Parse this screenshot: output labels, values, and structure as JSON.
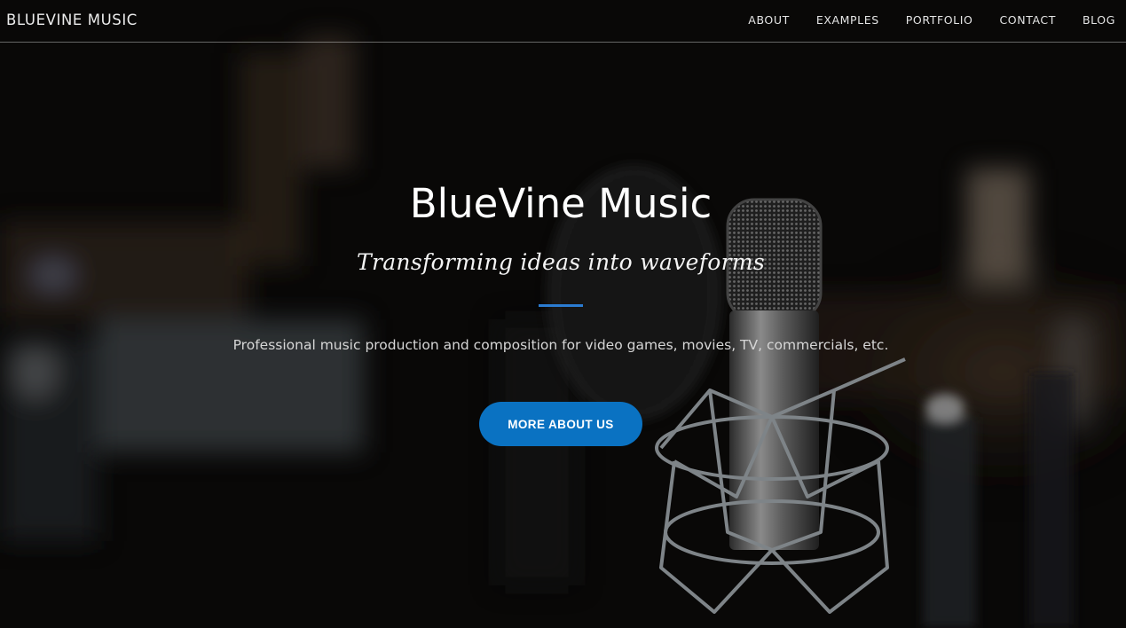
{
  "navbar": {
    "brand": "BLUEVINE MUSIC",
    "links": [
      "ABOUT",
      "EXAMPLES",
      "PORTFOLIO",
      "CONTACT",
      "BLOG"
    ]
  },
  "hero": {
    "title": "BlueVine Music",
    "subtitle": "Transforming ideas into waveforms",
    "tagline": "Professional music production and composition for video games, movies, TV, commercials, etc.",
    "cta_label": "MORE ABOUT US",
    "background_icon": "studio-microphone-photo"
  },
  "colors": {
    "accent": "#0a72c2",
    "divider": "#2b7cd1",
    "background": "#0b0a09",
    "text": "#ffffff"
  }
}
